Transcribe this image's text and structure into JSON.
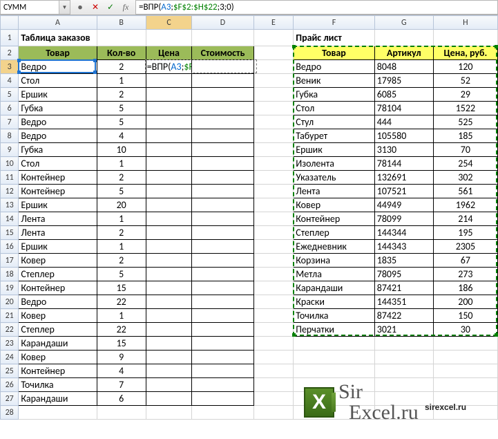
{
  "name_box": "СУММ",
  "formula": {
    "pre": "=ВПР(",
    "ref1": "A3",
    "sep1": ";",
    "ref2": "$F$2:$H$22",
    "tail": ";3;0)"
  },
  "cols": [
    "A",
    "B",
    "C",
    "D",
    "E",
    "F",
    "G",
    "H"
  ],
  "title_left": "Таблица заказов",
  "title_right": "Прайс лист",
  "left_headers": [
    "Товар",
    "Кол-во",
    "Цена",
    "Стоимость"
  ],
  "right_headers": [
    "Товар",
    "Артикул",
    "Цена, руб."
  ],
  "orders": [
    {
      "name": "Ведро",
      "qty": "2"
    },
    {
      "name": "Стол",
      "qty": "1"
    },
    {
      "name": "Ершик",
      "qty": "2"
    },
    {
      "name": "Губка",
      "qty": "5"
    },
    {
      "name": "Ведро",
      "qty": "5"
    },
    {
      "name": "Ведро",
      "qty": "4"
    },
    {
      "name": "Губка",
      "qty": "10"
    },
    {
      "name": "Стол",
      "qty": "1"
    },
    {
      "name": "Контейнер",
      "qty": "2"
    },
    {
      "name": "Контейнер",
      "qty": "5"
    },
    {
      "name": "Ершик",
      "qty": "20"
    },
    {
      "name": "Лента",
      "qty": "1"
    },
    {
      "name": "Лента",
      "qty": "2"
    },
    {
      "name": "Ершик",
      "qty": "1"
    },
    {
      "name": "Ковер",
      "qty": "2"
    },
    {
      "name": "Степлер",
      "qty": "5"
    },
    {
      "name": "Контейнер",
      "qty": "15"
    },
    {
      "name": "Ведро",
      "qty": "22"
    },
    {
      "name": "Ковер",
      "qty": "1"
    },
    {
      "name": "Степлер",
      "qty": "22"
    },
    {
      "name": "Карандаши",
      "qty": "15"
    },
    {
      "name": "Ковер",
      "qty": "9"
    },
    {
      "name": "Контейнер",
      "qty": "4"
    },
    {
      "name": "Точилка",
      "qty": "7"
    },
    {
      "name": "Карандаши",
      "qty": "6"
    }
  ],
  "prices": [
    {
      "name": "Ведро",
      "art": "8048",
      "price": "120"
    },
    {
      "name": "Веник",
      "art": "17985",
      "price": "52"
    },
    {
      "name": "Губка",
      "art": "6085",
      "price": "29"
    },
    {
      "name": "Стол",
      "art": "78104",
      "price": "1522"
    },
    {
      "name": "Стул",
      "art": "444",
      "price": "525"
    },
    {
      "name": "Табурет",
      "art": "105580",
      "price": "185"
    },
    {
      "name": "Ершик",
      "art": "3130",
      "price": "70"
    },
    {
      "name": "Изолента",
      "art": "78144",
      "price": "254"
    },
    {
      "name": "Указатель",
      "art": "132691",
      "price": "302"
    },
    {
      "name": "Лента",
      "art": "107521",
      "price": "561"
    },
    {
      "name": "Ковер",
      "art": "44949",
      "price": "1962"
    },
    {
      "name": "Контейнер",
      "art": "78099",
      "price": "214"
    },
    {
      "name": "Степлер",
      "art": "144344",
      "price": "195"
    },
    {
      "name": "Ежедневник",
      "art": "144343",
      "price": "2305"
    },
    {
      "name": "Корзина",
      "art": "1835",
      "price": "67"
    },
    {
      "name": "Метла",
      "art": "78095",
      "price": "273"
    },
    {
      "name": "Карандаши",
      "art": "87421",
      "price": "186"
    },
    {
      "name": "Краски",
      "art": "144351",
      "price": "200"
    },
    {
      "name": "Точилка",
      "art": "87422",
      "price": "150"
    },
    {
      "name": "Перчатки",
      "art": "3021",
      "price": "30"
    }
  ],
  "logo_text": "SirExcel.ru",
  "url_text": "sirexcel.ru",
  "fb_icons": {
    "circle": "●",
    "cancel": "✕",
    "accept": "✓",
    "fx": "fx"
  }
}
